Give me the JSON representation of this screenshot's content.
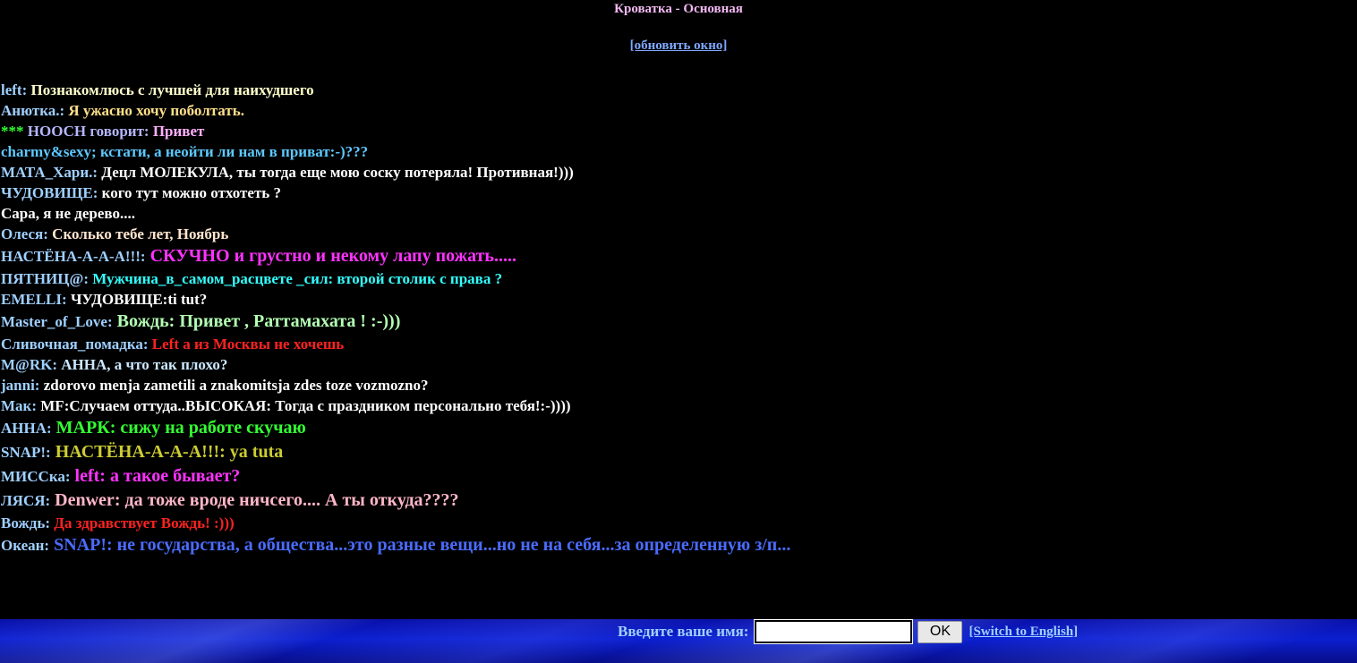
{
  "header": {
    "title": "Кроватка - Основная",
    "refresh_label": "[обновить окно]"
  },
  "messages": [
    {
      "nick": "left:",
      "text": "Познакомлюсь с лучшей для наихудшего",
      "nick_color": "#9fd0ff",
      "text_color": "#ffffcc",
      "size": "sm"
    },
    {
      "nick": "Анютка.:",
      "text": "Я ужасно хочу поболтать.",
      "nick_color": "#9fd0ff",
      "text_color": "#ffe08a",
      "size": "sm"
    },
    {
      "nick": "*** НООСН говорит:",
      "text": "Привет",
      "nick_color": "#b6b6ff",
      "text_color": "#ffb0ff",
      "prefix": "***",
      "prefix_color": "#33ff33",
      "size": "sm"
    },
    {
      "nick": "",
      "text": "charmy&sexy; кстати, а неойти ли нам в приват:-)???",
      "nick_color": "#9fd0ff",
      "text_color": "#5ec8ff",
      "size": "sm"
    },
    {
      "nick": "МАТА_Хари.:",
      "text": "Децл МОЛЕКУЛА, ты тогда еще мою соску потеряла! Противная!)))",
      "nick_color": "#9fd0ff",
      "text_color": "#ffffff",
      "size": "sm"
    },
    {
      "nick": "ЧУДОВИЩЕ:",
      "text": "кого тут можно отхотеть ?",
      "nick_color": "#9fd0ff",
      "text_color": "#ffffff",
      "size": "sm"
    },
    {
      "nick": "",
      "text": "Сара, я не дерево....",
      "nick_color": "#9fd0ff",
      "text_color": "#ffffff",
      "size": "sm"
    },
    {
      "nick": "Олеся:",
      "text": "Сколько тебе лет, Ноябрь",
      "nick_color": "#9fd0ff",
      "text_color": "#ffe6d0",
      "size": "sm"
    },
    {
      "nick": "НАСТЁНА-А-А-А!!!:",
      "text": "СКУЧНО и грустно и некому лапу пожать.....",
      "nick_color": "#9fd0ff",
      "text_color": "#ff33ff",
      "size": "big"
    },
    {
      "nick": "ПЯТНИЦ@:",
      "text": "Мужчина_в_самом_расцвете _сил: второй столик с права ?",
      "nick_color": "#9fd0ff",
      "text_color": "#33ffff",
      "size": "sm"
    },
    {
      "nick": "EMELLI:",
      "text": "ЧУДОВИЩЕ:ti tut?",
      "nick_color": "#9fd0ff",
      "text_color": "#ffffff",
      "size": "sm"
    },
    {
      "nick": "Master_of_Love:",
      "text": "Вождь: Привет , Раттамахата ! :-)))",
      "nick_color": "#9fd0ff",
      "text_color": "#b3ffb3",
      "size": "big"
    },
    {
      "nick": "Сливочная_помадка:",
      "text": "Left а из Москвы не хочешь",
      "nick_color": "#9fd0ff",
      "text_color": "#ff2222",
      "size": "sm"
    },
    {
      "nick": "M@RK:",
      "text": "АННА, а что так плохо?",
      "nick_color": "#9fd0ff",
      "text_color": "#cce8ff",
      "size": "sm"
    },
    {
      "nick": "janni:",
      "text": "zdorovo menja zametili a znakomitsja zdes toze vozmozno?",
      "nick_color": "#9fd0ff",
      "text_color": "#ffffff",
      "size": "sm"
    },
    {
      "nick": "Мак:",
      "text": "MF:Случаем оттуда..ВЫСОКАЯ: Тогда с праздником персонально тебя!:-))))",
      "nick_color": "#9fd0ff",
      "text_color": "#ffffff",
      "size": "sm"
    },
    {
      "nick": "АННА:",
      "text": "МАРК: сижу на работе скучаю",
      "nick_color": "#9fd0ff",
      "text_color": "#33ff33",
      "size": "big"
    },
    {
      "nick": "SNAP!:",
      "text": "НАСТЁНА-А-А-А!!!: ya tuta",
      "nick_color": "#9fd0ff",
      "text_color": "#cccc33",
      "size": "big"
    },
    {
      "nick": "МИССка:",
      "text": "left: а такое бывает?",
      "nick_color": "#9fd0ff",
      "text_color": "#ff33ff",
      "size": "big"
    },
    {
      "nick": "ЛЯСЯ:",
      "text": "Denwer: да тоже вроде ничсего.... А ты откуда????",
      "nick_color": "#9fd0ff",
      "text_color": "#ffb6c8",
      "size": "big"
    },
    {
      "nick": "Вождь:",
      "text": "Да здравствует Вождь! :)))",
      "nick_color": "#9fd0ff",
      "text_color": "#ff2222",
      "size": "sm"
    },
    {
      "nick": "Океан:",
      "text": "SNAP!: не государства, а общества...это разные вещи...но не на себя...за определенную з/п...",
      "nick_color": "#9fd0ff",
      "text_color": "#4a6cff",
      "size": "big"
    }
  ],
  "login": {
    "label": "Введите ваше имя:",
    "input_value": "",
    "ok_label": "OK",
    "switch_label": "[Switch to English]"
  }
}
